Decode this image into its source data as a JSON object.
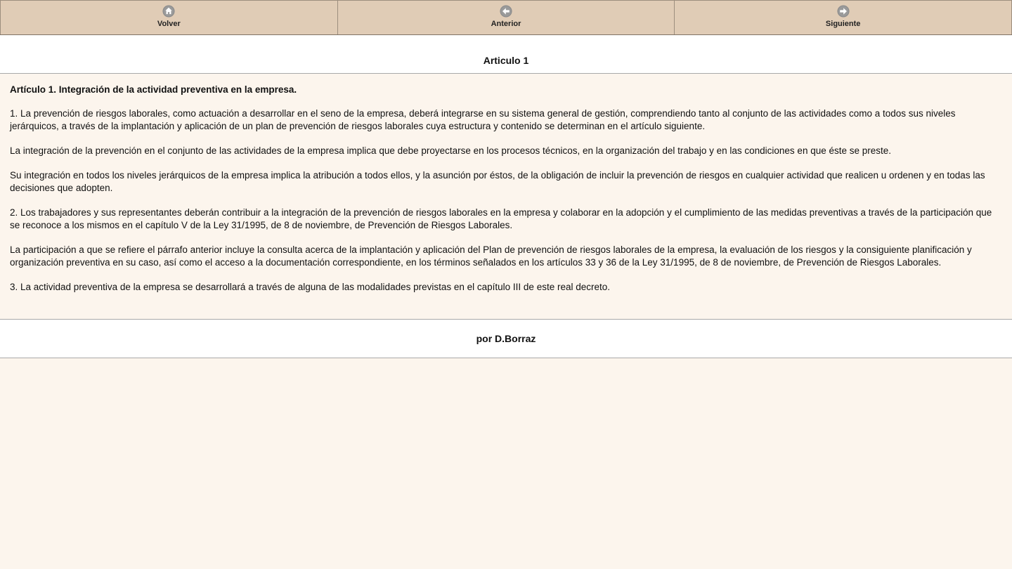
{
  "toolbar": {
    "buttons": [
      {
        "label": "Volver",
        "icon": "home-icon"
      },
      {
        "label": "Anterior",
        "icon": "arrow-left-icon"
      },
      {
        "label": "Siguiente",
        "icon": "arrow-right-icon"
      }
    ]
  },
  "header": {
    "title": "Articulo 1"
  },
  "article": {
    "heading": "Artículo 1. Integración de la actividad preventiva en la empresa.",
    "paragraphs": [
      "1. La prevención de riesgos laborales, como actuación a desarrollar en el seno de la empresa, deberá integrarse en su sistema general de gestión, comprendiendo tanto al conjunto de las actividades como a todos sus niveles jerárquicos, a través de la implantación y aplicación de un plan de prevención de riesgos laborales cuya estructura y contenido se determinan en el artículo siguiente.",
      "La integración de la prevención en el conjunto de las actividades de la empresa implica que debe proyectarse en los procesos técnicos, en la organización del trabajo y en las condiciones en que éste se preste.",
      "Su integración en todos los niveles jerárquicos de la empresa implica la atribución a todos ellos, y la asunción por éstos, de la obligación de incluir la prevención de riesgos en cualquier actividad que realicen u ordenen y en todas las decisiones que adopten.",
      "2. Los trabajadores y sus representantes deberán contribuir a la integración de la prevención de riesgos laborales en la empresa y colaborar en la adopción y el cumplimiento de las medidas preventivas a través de la participación que se reconoce a los mismos en el capítulo V de la Ley 31/1995, de 8 de noviembre, de Prevención de Riesgos Laborales.",
      "La participación a que se refiere el párrafo anterior incluye la consulta acerca de la implantación y aplicación del Plan de prevención de riesgos laborales de la empresa, la evaluación de los riesgos y la consiguiente planificación y organización preventiva en su caso, así como el acceso a la documentación correspondiente, en los términos señalados en los artículos 33 y 36 de la Ley 31/1995, de 8 de noviembre, de Prevención de Riesgos Laborales.",
      "3. La actividad preventiva de la empresa se desarrollará a través de alguna de las modalidades previstas en el capítulo III de este real decreto."
    ]
  },
  "footer": {
    "credit": "por D.Borraz"
  },
  "colors": {
    "toolbar_bg": "#e0ccb6",
    "content_bg": "#fcf5ed",
    "icon_gray": "#8a8a8a"
  }
}
